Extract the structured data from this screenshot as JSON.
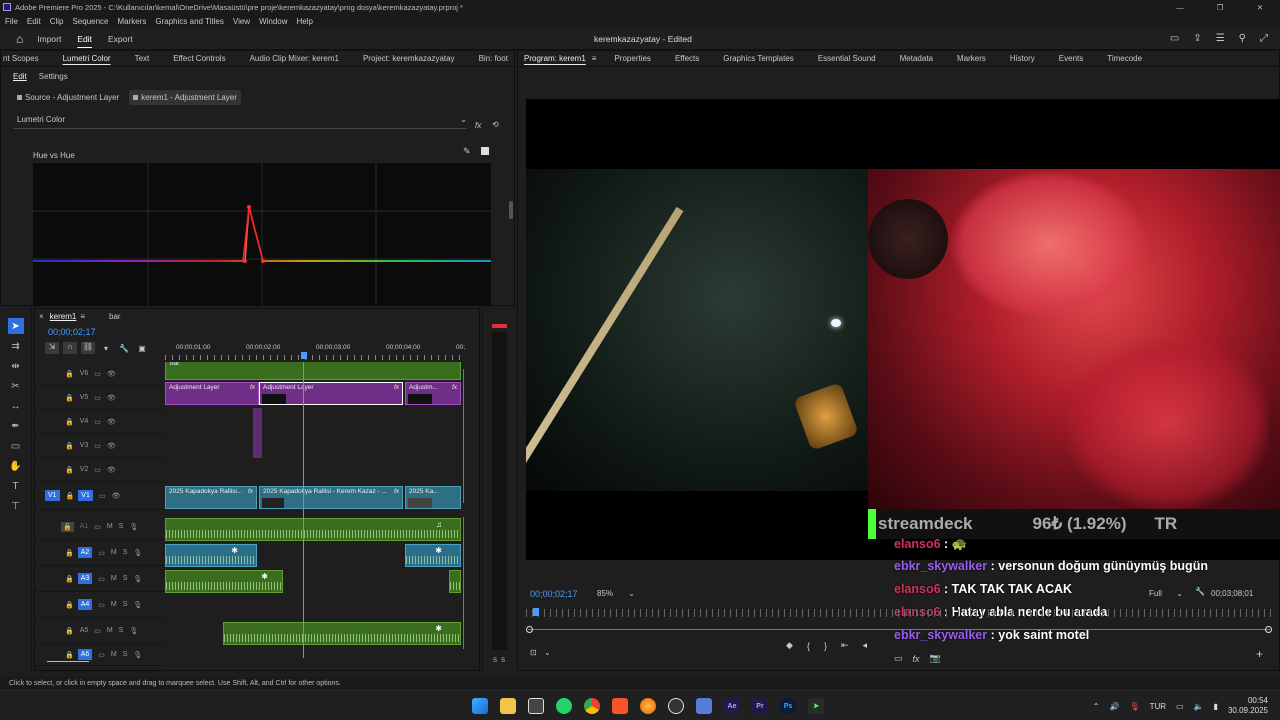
{
  "window": {
    "title": "Adobe Premiere Pro 2025 - C:\\Kullanıcılar\\kemal\\OneDrive\\Masaüstü\\pre proje\\keremkazazyatay\\prog dosya\\keremkazazyatay.prproj *"
  },
  "menu": [
    "File",
    "Edit",
    "Clip",
    "Sequence",
    "Markers",
    "Graphics and Titles",
    "View",
    "Window",
    "Help"
  ],
  "header": {
    "nav": [
      "Import",
      "Edit",
      "Export"
    ],
    "active_nav": "Edit",
    "project_title": "keremkazazyatay - Edited"
  },
  "left_tabs": [
    "nt Scopes",
    "Lumetri Color",
    "Text",
    "Effect Controls",
    "Audio Clip Mixer: kerem1",
    "Project: keremkazazyatay",
    "Bin: foot",
    "So"
  ],
  "left_active_tab": "Lumetri Color",
  "lumetri": {
    "subtabs": [
      "Edit",
      "Settings"
    ],
    "source_label": "Source - Adjustment Layer",
    "target_label": "kerem1 - Adjustment Layer",
    "effect_select": "Lumetri Color",
    "curve_title": "Hue vs Hue"
  },
  "right_tabs": [
    "Program: kerem1",
    "Properties",
    "Effects",
    "Graphics Templates",
    "Essential Sound",
    "Metadata",
    "Markers",
    "History",
    "Events",
    "Timecode"
  ],
  "program": {
    "timecode": "00;00;02;17",
    "zoom": "85%",
    "quality": "Full",
    "duration": "00;03;08;01",
    "overlay": {
      "brand": "streamdeck",
      "price": "96₺ (1.92%)",
      "price_tail": "TR"
    },
    "chat": [
      {
        "user": "elanso6",
        "sep": " :",
        "msg": " 🐢",
        "user_color": "#d3315a"
      },
      {
        "user": "ebkr_skywalker",
        "sep": " :",
        "msg": " versonun doğum günüymüş bugün",
        "user_color": "#9b5cf2"
      },
      {
        "user": "elanso6",
        "sep": " :",
        "msg": " TAK TAK TAK ACAK",
        "user_color": "#d3315a"
      },
      {
        "user": "elanso6",
        "sep": " :",
        "msg": " Hatay abla nerde bu arada",
        "user_color": "#d3315a"
      },
      {
        "user": "ebkr_skywalker",
        "sep": " :",
        "msg": " yok saint motel",
        "user_color": "#9b5cf2"
      }
    ]
  },
  "timeline": {
    "tabs": [
      "kerem1",
      "bar"
    ],
    "timecode": "00;00;02;17",
    "ruler": [
      "00;00;01;00",
      "00;00;02;00",
      "00;00;03;00",
      "00;00;04;00",
      "00;"
    ],
    "video_tracks": [
      "V6",
      "V5",
      "V4",
      "V3",
      "V2",
      "V1"
    ],
    "audio_tracks": [
      "A1",
      "A2",
      "A3",
      "A4",
      "A5",
      "A6"
    ],
    "source_patch_v": "V1",
    "adjustment_clips": [
      "Adjustment Layer",
      "Adjustment Layer",
      "Adjustm..."
    ],
    "v1_clips": [
      "2025 Kapadokya Rallisi...",
      "2025 Kapadokya Rallisi - Kerem Kazaz - ...",
      "2025 Ka..."
    ],
    "top_clip": "bar",
    "fx": "fx",
    "mute": "M",
    "solo": "S",
    "meter_labels": [
      "S",
      "S"
    ]
  },
  "status_bar": "Click to select, or click in empty space and drag to marquee select. Use Shift, Alt, and Ctrl for other options.",
  "taskbar": {
    "apps": [
      "Ae",
      "Pr",
      "Ps"
    ],
    "language": "TUR",
    "time": "00:54",
    "date": "30.09.2025"
  }
}
